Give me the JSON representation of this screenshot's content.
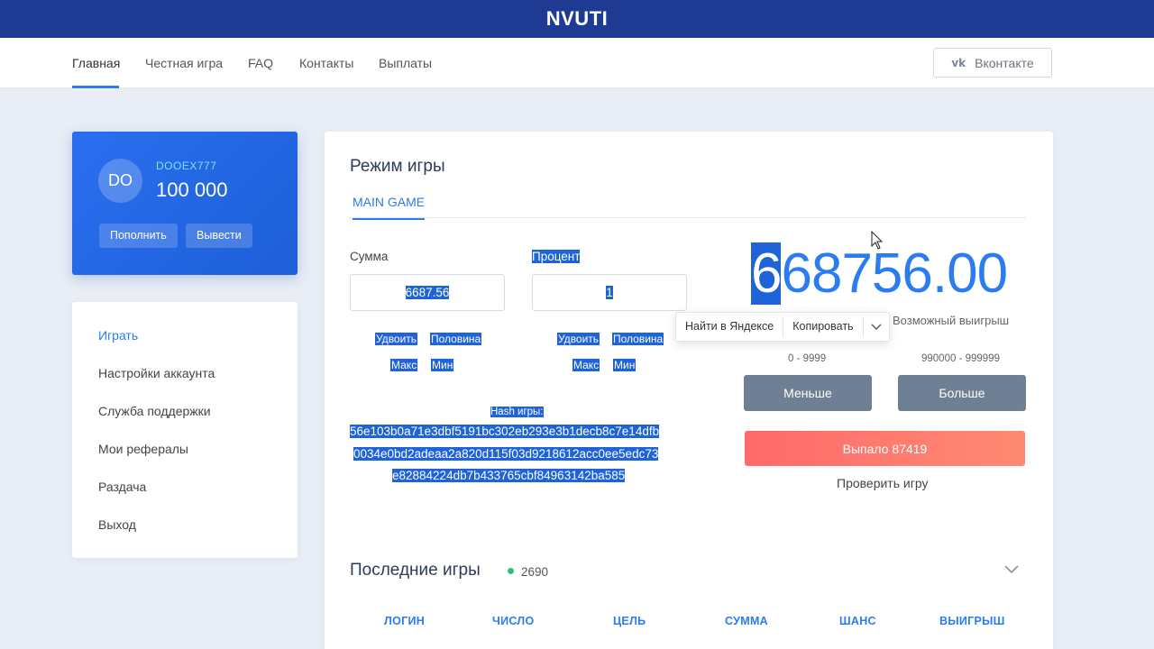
{
  "app": {
    "brand": "NVUTI"
  },
  "nav": {
    "items": [
      "Главная",
      "Честная игра",
      "FAQ",
      "Контакты",
      "Выплаты"
    ],
    "vk_label": "Вконтакте"
  },
  "profile": {
    "initials": "DO",
    "username": "DOOEX777",
    "balance": "100 000",
    "deposit_label": "Пополнить",
    "withdraw_label": "Вывести"
  },
  "menu": {
    "items": [
      "Играть",
      "Настройки аккаунта",
      "Служба поддержки",
      "Мои рефералы",
      "Раздача",
      "Выход"
    ]
  },
  "game": {
    "title": "Режим игры",
    "tab": "MAIN GAME",
    "amount_label": "Сумма",
    "amount_value": "6687.56",
    "percent_label": "Процент",
    "percent_value": "1",
    "chips": {
      "double": "Удвоить",
      "half": "Половина",
      "max": "Макс",
      "min": "Мин"
    },
    "hash_title": "Hash игры:",
    "hash_lines": [
      "56e103b0a71e3dbf5191bc302eb293e3b1decb8c7e14dfb",
      "0034e0bd2adeaa2a820d115f03d9218612acc0ee5edc73",
      "e82884224db7b433765cbf84963142ba585"
    ],
    "win_first_digit": "6",
    "win_rest": "68756.00",
    "win_label": "Возможный выигрыш",
    "range_low": "0 - 9999",
    "range_high": "990000 - 999999",
    "less_label": "Меньше",
    "more_label": "Больше",
    "result_label": "Выпало 87419",
    "check_label": "Проверить игру"
  },
  "context_menu": {
    "find": "Найти в Яндексе",
    "copy": "Копировать"
  },
  "recent": {
    "title": "Последние игры",
    "count": "2690",
    "columns": [
      "ЛОГИН",
      "ЧИСЛО",
      "ЦЕЛЬ",
      "СУММА",
      "ШАНС",
      "ВЫИГРЫШ"
    ]
  }
}
